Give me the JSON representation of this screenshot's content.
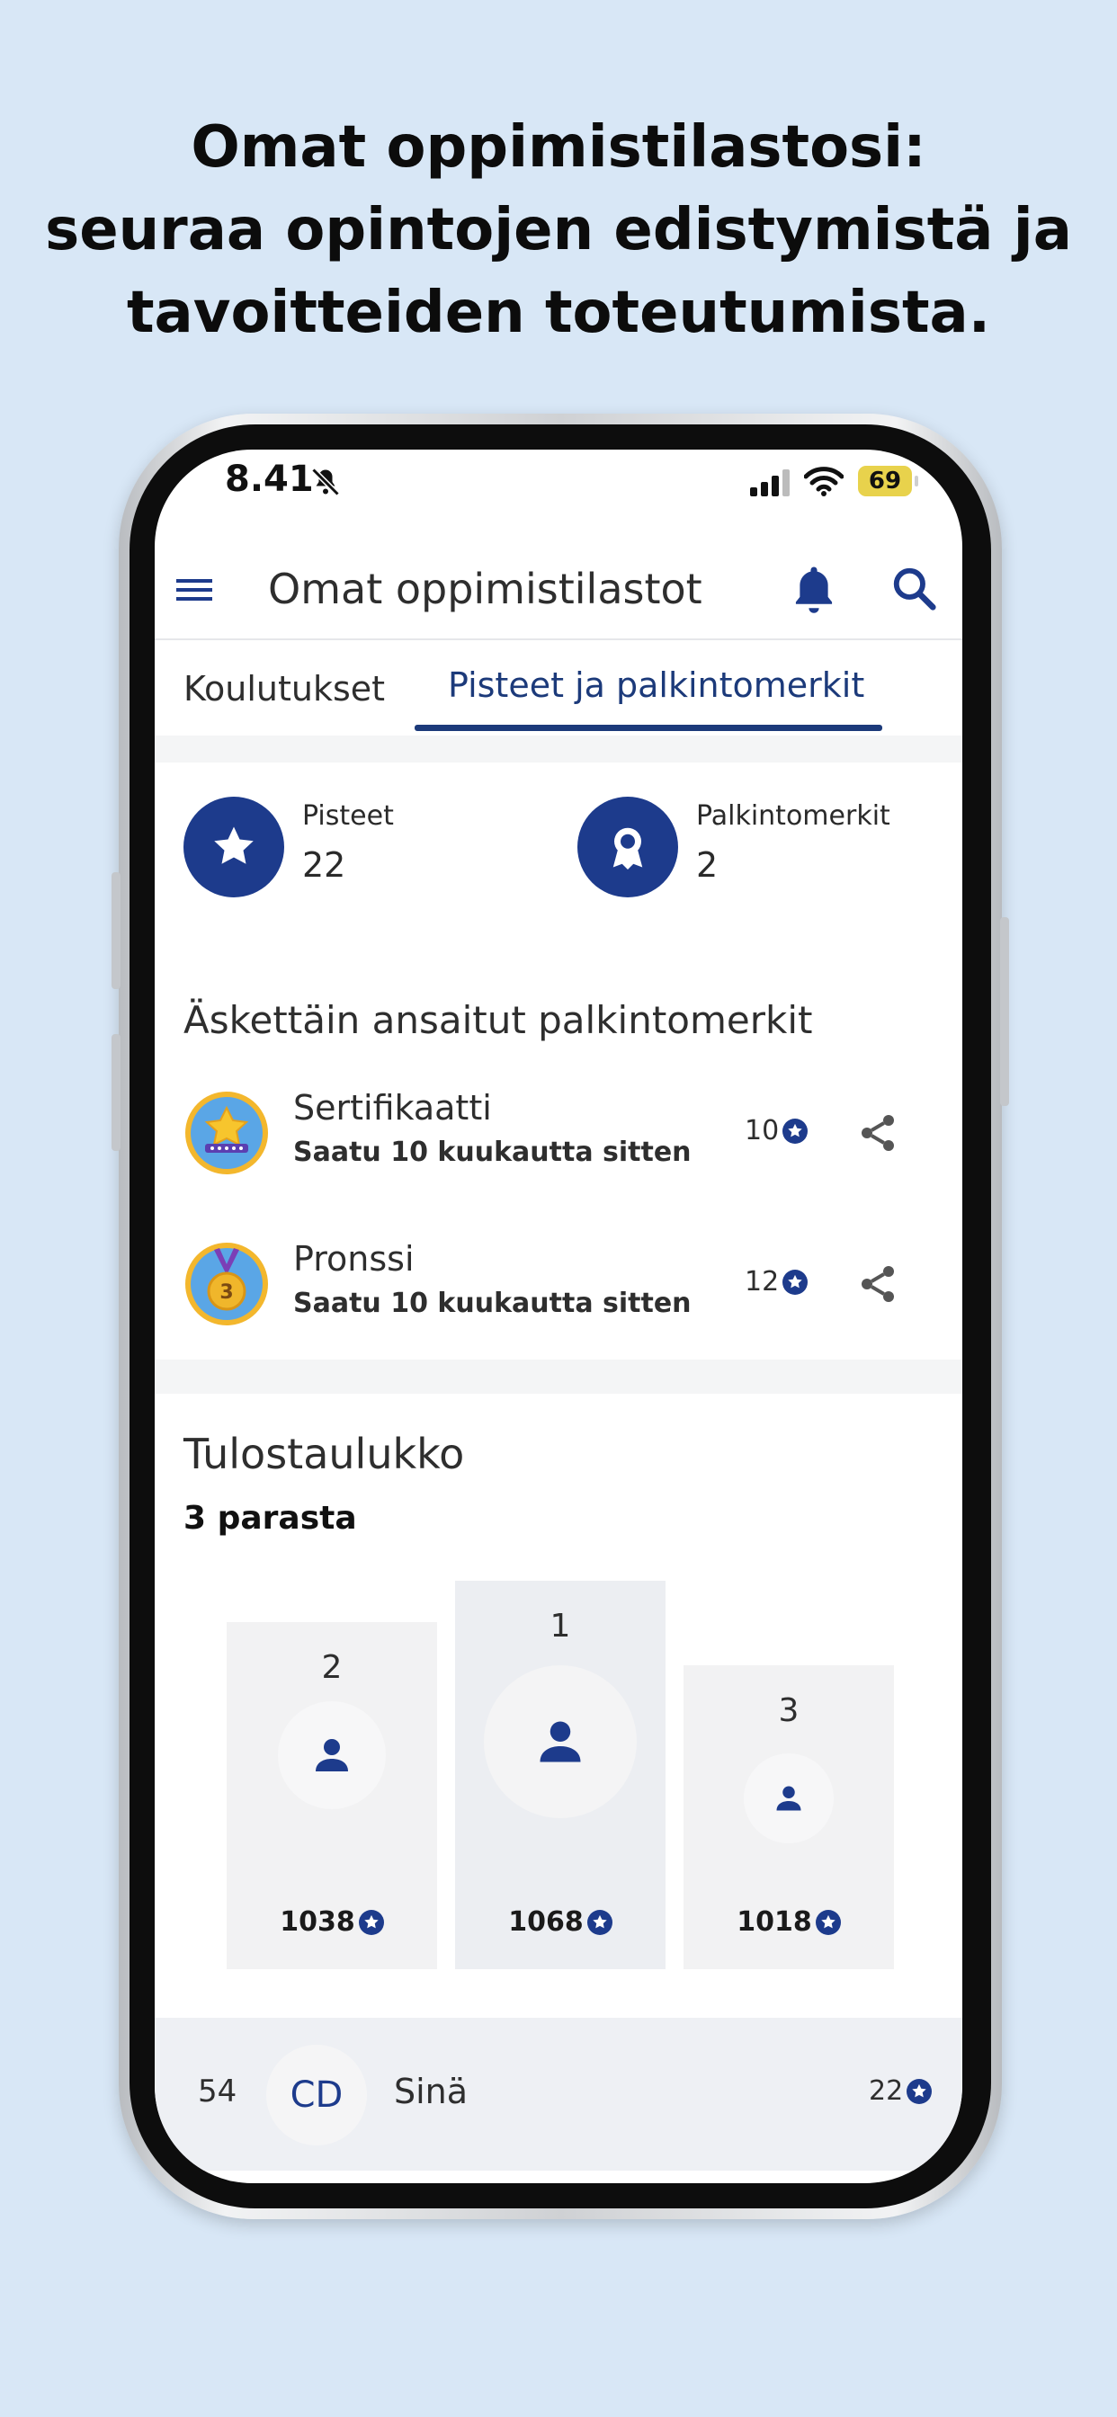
{
  "headline": {
    "line1": "Omat oppimistilastosi:",
    "line2": "seuraa opintojen edistymistä ja",
    "line3": "tavoitteiden toteutumista."
  },
  "status_bar": {
    "time": "8.41",
    "battery": "69"
  },
  "app_bar": {
    "title": "Omat oppimistilastot"
  },
  "tabs": [
    {
      "label": "Koulutukset",
      "active": false
    },
    {
      "label": "Pisteet ja palkintomerkit",
      "active": true
    }
  ],
  "summary": {
    "points_label": "Pisteet",
    "points_value": "22",
    "badges_label": "Palkintomerkit",
    "badges_value": "2"
  },
  "recent_badges": {
    "title": "Äskettäin ansaitut palkintomerkit",
    "items": [
      {
        "name": "Sertifikaatti",
        "earned": "Saatu 10 kuukautta sitten",
        "points": "10",
        "icon": "certificate-star-badge-icon"
      },
      {
        "name": "Pronssi",
        "earned": "Saatu 10 kuukautta sitten",
        "points": "12",
        "icon": "bronze-medal-badge-icon"
      }
    ]
  },
  "leaderboard": {
    "title": "Tulostaulukko",
    "subtitle": "3 parasta",
    "podium": [
      {
        "rank": "2",
        "score": "1038"
      },
      {
        "rank": "1",
        "score": "1068"
      },
      {
        "rank": "3",
        "score": "1018"
      }
    ],
    "me": {
      "rank": "54",
      "initials": "CD",
      "name": "Sinä",
      "points": "22"
    }
  },
  "colors": {
    "background": "#d8e7f6",
    "brand_navy": "#1d3b8c",
    "tab_active": "#1c3a7a",
    "battery": "#e8d24c"
  }
}
